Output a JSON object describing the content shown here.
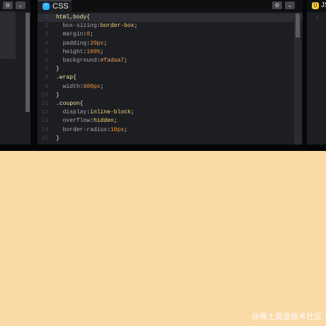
{
  "left_pane": {
    "gear_icon": "gear-icon",
    "chevron_icon": "chevron-down-icon"
  },
  "css_pane": {
    "tab_label": "CSS",
    "tab_badge": "*",
    "lines": [
      {
        "n": "1",
        "parts": [
          [
            "sel",
            "html,body"
          ],
          [
            "plain",
            "{"
          ]
        ]
      },
      {
        "n": "2",
        "parts": [
          [
            "plain",
            "  "
          ],
          [
            "prop",
            "box-sizing"
          ],
          [
            "plain",
            ":"
          ],
          [
            "val",
            "border-box"
          ],
          [
            "plain",
            ";"
          ]
        ]
      },
      {
        "n": "3",
        "parts": [
          [
            "plain",
            "  "
          ],
          [
            "prop",
            "margin"
          ],
          [
            "plain",
            ":"
          ],
          [
            "num",
            "0"
          ],
          [
            "plain",
            ";"
          ]
        ]
      },
      {
        "n": "4",
        "parts": [
          [
            "plain",
            "  "
          ],
          [
            "prop",
            "padding"
          ],
          [
            "plain",
            ":"
          ],
          [
            "num",
            "20px"
          ],
          [
            "plain",
            ";"
          ]
        ]
      },
      {
        "n": "5",
        "parts": [
          [
            "plain",
            "  "
          ],
          [
            "prop",
            "height"
          ],
          [
            "plain",
            ":"
          ],
          [
            "num",
            "100%"
          ],
          [
            "plain",
            ";"
          ]
        ]
      },
      {
        "n": "6",
        "parts": [
          [
            "plain",
            "  "
          ],
          [
            "prop",
            "background"
          ],
          [
            "plain",
            ":"
          ],
          [
            "str",
            "#fadaa7"
          ],
          [
            "plain",
            ";"
          ]
        ]
      },
      {
        "n": "7",
        "parts": [
          [
            "plain",
            "}"
          ]
        ]
      },
      {
        "n": "8",
        "parts": [
          [
            "sel",
            ".wrap"
          ],
          [
            "plain",
            "{"
          ]
        ]
      },
      {
        "n": "9",
        "parts": [
          [
            "plain",
            "  "
          ],
          [
            "prop",
            "width"
          ],
          [
            "plain",
            ":"
          ],
          [
            "num",
            "600px"
          ],
          [
            "plain",
            ";"
          ]
        ]
      },
      {
        "n": "10",
        "parts": [
          [
            "plain",
            "}"
          ]
        ]
      },
      {
        "n": "11",
        "parts": [
          [
            "sel",
            ".coupon"
          ],
          [
            "plain",
            "{"
          ]
        ]
      },
      {
        "n": "12",
        "parts": [
          [
            "plain",
            "  "
          ],
          [
            "prop",
            "display"
          ],
          [
            "plain",
            ":"
          ],
          [
            "val",
            "inline-block"
          ],
          [
            "plain",
            ";"
          ]
        ]
      },
      {
        "n": "13",
        "parts": [
          [
            "plain",
            "  "
          ],
          [
            "prop",
            "overflow"
          ],
          [
            "plain",
            ":"
          ],
          [
            "val",
            "hidden"
          ],
          [
            "plain",
            ";"
          ]
        ]
      },
      {
        "n": "14",
        "parts": [
          [
            "plain",
            "  "
          ],
          [
            "prop",
            "border-radius"
          ],
          [
            "plain",
            ":"
          ],
          [
            "num",
            "10px"
          ],
          [
            "plain",
            ";"
          ]
        ]
      },
      {
        "n": "15",
        "parts": [
          [
            "plain",
            "}"
          ]
        ]
      }
    ]
  },
  "js_pane": {
    "tab_label": "JS",
    "tab_badge": "()",
    "line_number": "1"
  },
  "watermark": "@稀土掘金技术社区",
  "colors": {
    "page_bg": "#fadaa7",
    "editor_bg": "#1d1e22",
    "css_badge": "#2ab3ff",
    "js_badge": "#f4cc36"
  }
}
